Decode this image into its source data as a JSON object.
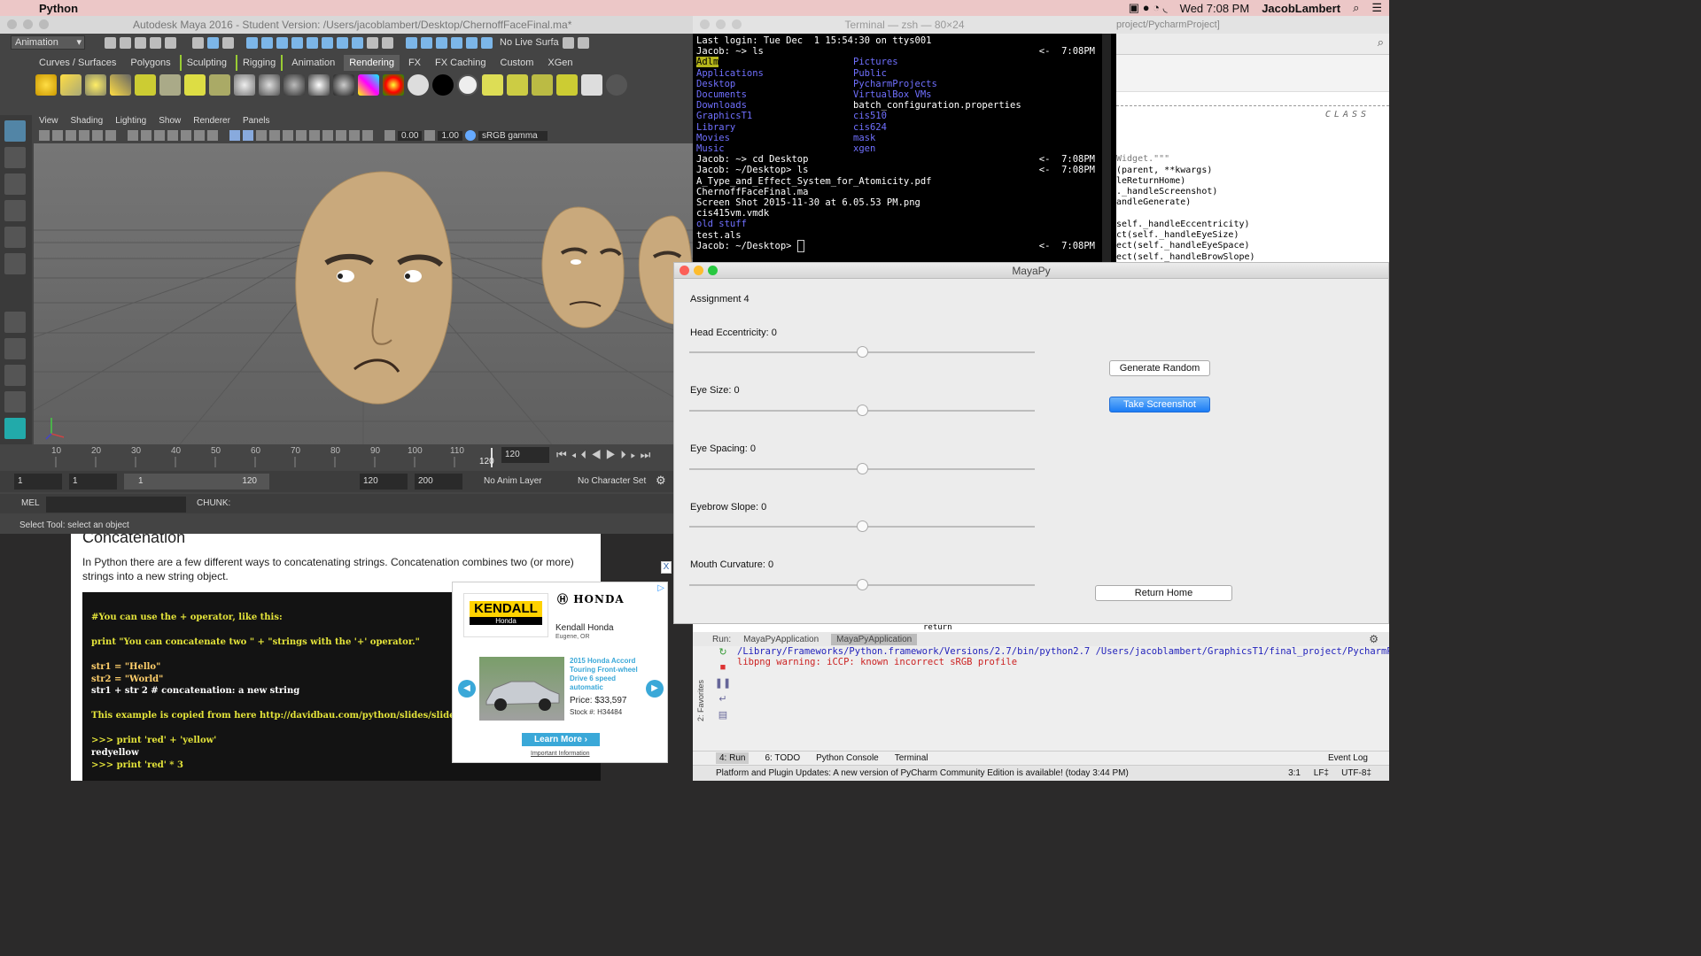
{
  "menubar": {
    "app": "Python",
    "clock": "Wed 7:08 PM",
    "user": "JacobLambert"
  },
  "maya": {
    "title": "Autodesk Maya 2016 - Student Version: /Users/jacoblambert/Desktop/ChernoffFaceFinal.ma*",
    "mode": "Animation",
    "live": "No Live Surfa",
    "shelf_tabs": [
      "Curves / Surfaces",
      "Polygons",
      "Sculpting",
      "Rigging",
      "Animation",
      "Rendering",
      "FX",
      "FX Caching",
      "Custom",
      "XGen"
    ],
    "active_shelf": "Rendering",
    "panel_menu": [
      "View",
      "Shading",
      "Lighting",
      "Show",
      "Renderer",
      "Panels"
    ],
    "vp_val1": "0.00",
    "vp_val2": "1.00",
    "gamma": "sRGB gamma",
    "camera": "persp",
    "ticks": [
      "10",
      "20",
      "30",
      "40",
      "50",
      "60",
      "70",
      "80",
      "90",
      "100",
      "110"
    ],
    "tick_120": "120",
    "current_frame": "120",
    "range": {
      "start": "1",
      "start2": "1",
      "slider_start": "1",
      "slider_end": "120",
      "end": "120",
      "max": "200",
      "anim_layer": "No Anim Layer",
      "character": "No Character Set"
    },
    "mel_label": "MEL",
    "chunk": "CHUNK:",
    "help": "Select Tool: select an object",
    "colors": {
      "skin": "#c9a97c",
      "accent": "#5285a6"
    }
  },
  "terminal": {
    "title": "Terminal — zsh — 80×24",
    "login": "Last login: Tue Dec  1 15:54:30 on ttys001",
    "prompt1": "Jacob: ~> ls",
    "time": "<-  7:08PM",
    "ls_left": [
      "Adlm",
      "Applications",
      "Desktop",
      "Documents",
      "Downloads",
      "GraphicsT1",
      "Library",
      "Movies",
      "Music"
    ],
    "ls_right": [
      "Pictures",
      "Public",
      "PycharmProjects",
      "VirtualBox VMs",
      "batch_configuration.properties",
      "cis510",
      "cis624",
      "mask",
      "xgen"
    ],
    "prompt2": "Jacob: ~> cd Desktop",
    "prompt3": "Jacob: ~/Desktop> ls",
    "files": [
      "A_Type_and_Effect_System_for_Atomicity.pdf",
      "ChernoffFaceFinal.ma",
      "Screen Shot 2015-11-30 at 6.05.53 PM.png",
      "cis415vm.vmdk"
    ],
    "dir_old": "old stuff",
    "file_last": "test.als",
    "prompt4": "Jacob: ~/Desktop> "
  },
  "pycharm": {
    "path": "project/PycharmProject]",
    "class_label": "CLASS",
    "code": [
      "Widget.\"\"\"",
      "(parent, **kwargs)",
      "leReturnHome)",
      "._handleScreenshot)",
      "andleGenerate)",
      "",
      "self._handleEccentricity)",
      "ct(self._handleEyeSize)",
      "ect(self._handleEyeSpace)",
      "ect(self._handleBrowSlope)"
    ],
    "run_label": "Run:",
    "run_tabs": [
      "MayaPyApplication",
      "MayaPyApplication"
    ],
    "run_cmd": "/Library/Frameworks/Python.framework/Versions/2.7/bin/python2.7 /Users/jacoblambert/GraphicsT1/final_project/PycharmProject",
    "run_warn": "libpng warning: iCCP: known incorrect sRGB profile",
    "favorites": "2: Favorites",
    "bottom_tabs": [
      "4: Run",
      "6: TODO",
      "Python Console",
      "Terminal"
    ],
    "event_log": "Event Log",
    "status": "Platform and Plugin Updates: A new version of PyCharm Community Edition is available! (today 3:44 PM)",
    "pos": "3:1",
    "lf": "LF‡",
    "enc": "UTF-8‡",
    "partial": "return"
  },
  "mayapy": {
    "title": "MayaPy",
    "heading": "Assignment 4",
    "sliders": [
      {
        "label": "Head Eccentricity: 0",
        "value": 0.5
      },
      {
        "label": "Eye Size: 0",
        "value": 0.5
      },
      {
        "label": "Eye Spacing: 0",
        "value": 0.5
      },
      {
        "label": "Eyebrow Slope: 0",
        "value": 0.5
      },
      {
        "label": "Mouth Curvature: 0",
        "value": 0.5
      }
    ],
    "btn_generate": "Generate Random",
    "btn_screenshot": "Take Screenshot",
    "btn_home": "Return Home"
  },
  "web": {
    "heading": "Concatenation",
    "para": "In Python there are a few different ways to concatenating strings. Concatenation combines two (or more) strings into a new string object.",
    "close": "X",
    "code": [
      {
        "t": "#You can use the + operator, like this:",
        "c": "#e3e33a"
      },
      {
        "t": "",
        "c": "#fff"
      },
      {
        "t": "print \"You can concatenate two \" + \"strings with the '+' operator.\"",
        "c": "#e3e33a"
      },
      {
        "t": "",
        "c": "#fff"
      },
      {
        "t": "str1 = \"Hello\"",
        "c": "#ffcf6b"
      },
      {
        "t": "str2 = \"World\"",
        "c": "#ffcf6b"
      },
      {
        "t": "str1 + str 2      # concatenation: a new string",
        "c": "#fff"
      },
      {
        "t": "",
        "c": "#fff"
      },
      {
        "t": "This example is copied from here http://davidbau.com/python/slides/slide6.html",
        "c": "#e3e33a"
      },
      {
        "t": "",
        "c": "#fff"
      },
      {
        "t": ">>> print 'red' + 'yellow'",
        "c": "#e3e33a"
      },
      {
        "t": "redyellow",
        "c": "#fff"
      },
      {
        "t": ">>> print 'red' * 3",
        "c": "#e3e33a"
      }
    ],
    "ad": {
      "dealer_logo": "KENDALL",
      "dealer_sub": "Honda",
      "brand": "HONDA",
      "dealer": "Kendall Honda",
      "city": "Eugene, OR",
      "car": "2015 Honda Accord Touring Front-wheel Drive 6 speed automatic",
      "price": "Price: $33,597",
      "stock": "Stock #: H34484",
      "cta": "Learn More ›",
      "info": "Important Information",
      "adchoice": "▷"
    }
  }
}
